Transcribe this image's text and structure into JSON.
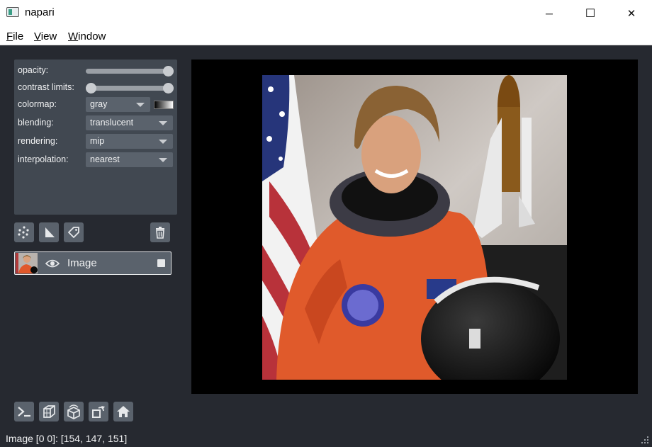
{
  "window": {
    "title": "napari",
    "minimize_glyph": "─",
    "maximize_glyph": "☐",
    "close_glyph": "✕"
  },
  "menu": {
    "file_first": "F",
    "file_rest": "ile",
    "view_first": "V",
    "view_rest": "iew",
    "window_first": "W",
    "window_rest": "indow"
  },
  "layer_controls": {
    "opacity_label": "opacity:",
    "opacity_value": 1.0,
    "contrast_label": "contrast limits:",
    "contrast_range": [
      0,
      1
    ],
    "colormap_label": "colormap:",
    "colormap_value": "gray",
    "blending_label": "blending:",
    "blending_value": "translucent",
    "rendering_label": "rendering:",
    "rendering_value": "mip",
    "interpolation_label": "interpolation:",
    "interpolation_value": "nearest"
  },
  "layer_buttons": {
    "new_points_icon": "points-icon",
    "new_shapes_icon": "shapes-icon",
    "new_labels_icon": "labels-tag-icon",
    "delete_icon": "trash-icon"
  },
  "layers": [
    {
      "name": "Image",
      "visible": true,
      "selected": true
    }
  ],
  "viewer_buttons": [
    "console-icon",
    "ndisplay-cube-icon",
    "roll-dims-icon",
    "transpose-icon",
    "home-icon"
  ],
  "status": {
    "text": "Image [0 0]: [154, 147, 151]"
  },
  "colors": {
    "background": "#262930",
    "panel": "#414851",
    "control": "#5a626c",
    "text": "#f0f1f2"
  }
}
